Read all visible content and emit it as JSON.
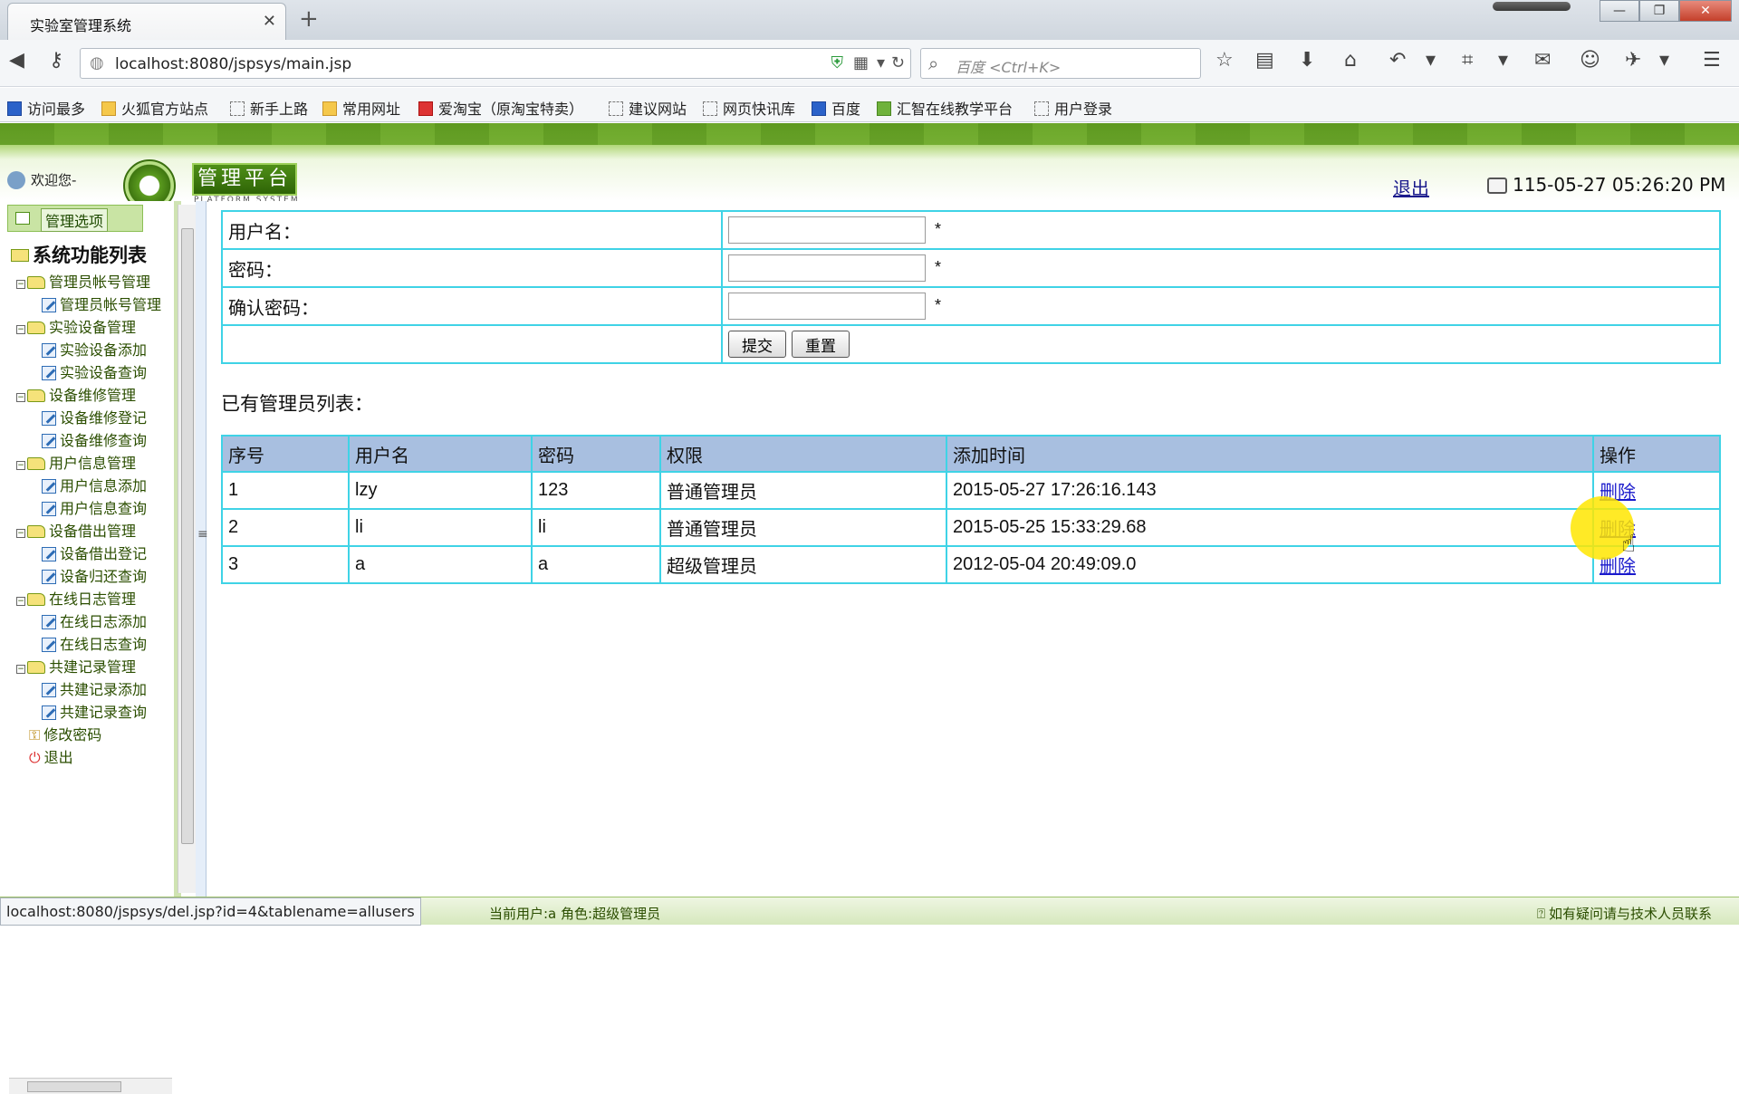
{
  "browser": {
    "tab_title": "实验室管理系统",
    "url": "localhost:8080/jspsys/main.jsp",
    "search_placeholder": "百度 <Ctrl+K>",
    "bookmarks": [
      "访问最多",
      "火狐官方站点",
      "新手上路",
      "常用网址",
      "爱淘宝（原淘宝特卖）",
      "建议网站",
      "网页快讯库",
      "百度",
      "汇智在线教学平台",
      "用户登录"
    ]
  },
  "header": {
    "welcome": "欢迎您-",
    "logo_text": "管理平台",
    "logo_sub": "PLATFORM SYSTEM",
    "logout": "退出",
    "datetime": "115-05-27 05:26:20 PM"
  },
  "sidebar": {
    "tab_label": "管理选项",
    "root": "系统功能列表",
    "groups": [
      {
        "label": "管理员帐号管理",
        "children": [
          "管理员帐号管理"
        ]
      },
      {
        "label": "实验设备管理",
        "children": [
          "实验设备添加",
          "实验设备查询"
        ]
      },
      {
        "label": "设备维修管理",
        "children": [
          "设备维修登记",
          "设备维修查询"
        ]
      },
      {
        "label": "用户信息管理",
        "children": [
          "用户信息添加",
          "用户信息查询"
        ]
      },
      {
        "label": "设备借出管理",
        "children": [
          "设备借出登记",
          "设备归还查询"
        ]
      },
      {
        "label": "在线日志管理",
        "children": [
          "在线日志添加",
          "在线日志查询"
        ]
      },
      {
        "label": "共建记录管理",
        "children": [
          "共建记录添加",
          "共建记录查询"
        ]
      }
    ],
    "change_password": "修改密码",
    "logout": "退出"
  },
  "form": {
    "username_label": "用户名：",
    "password_label": "密码：",
    "confirm_label": "确认密码：",
    "required_mark": "*",
    "submit": "提交",
    "reset": "重置"
  },
  "list": {
    "title": "已有管理员列表：",
    "columns": [
      "序号",
      "用户名",
      "密码",
      "权限",
      "添加时间",
      "操作"
    ],
    "rows": [
      {
        "no": "1",
        "username": "lzy",
        "password": "123",
        "role": "普通管理员",
        "time": "2015-05-27 17:26:16.143",
        "action": "删除"
      },
      {
        "no": "2",
        "username": "li",
        "password": "li",
        "role": "普通管理员",
        "time": "2015-05-25 15:33:29.68",
        "action": "删除"
      },
      {
        "no": "3",
        "username": "a",
        "password": "a",
        "role": "超级管理员",
        "time": "2012-05-04 20:49:09.0",
        "action": "删除"
      }
    ]
  },
  "status": {
    "hover_url": "localhost:8080/jspsys/del.jsp?id=4&tablename=allusers",
    "current_user": "当前用户:a  角色:超级管理员",
    "help": "如有疑问请与技术人员联系"
  },
  "colors": {
    "accent_green": "#5f9a21",
    "table_border": "#3fd3e6",
    "table_header": "#a8bfe0",
    "link": "#1a1acc"
  }
}
